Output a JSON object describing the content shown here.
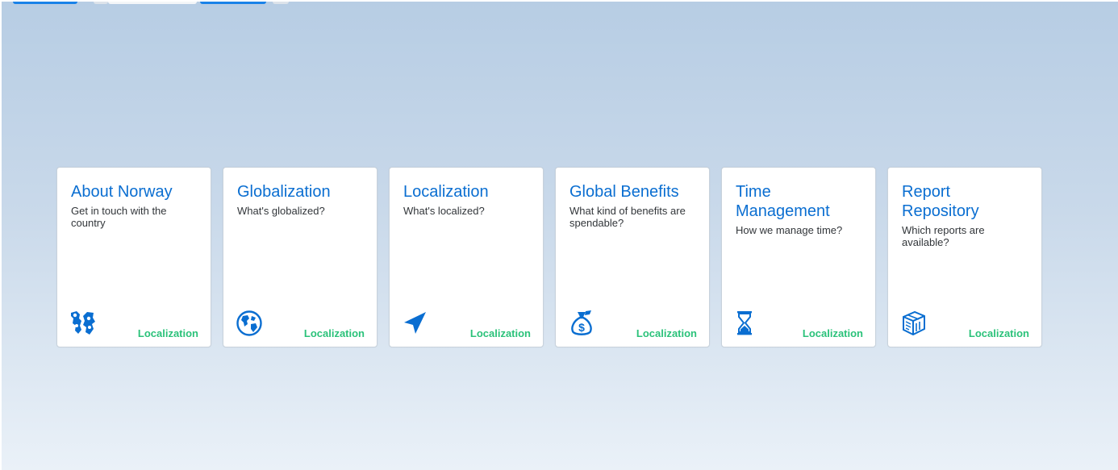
{
  "colors": {
    "tile_title": "#0a6ed1",
    "tile_footer": "#2bc27a",
    "tile_text": "#32363a",
    "icon": "#0a6ed1"
  },
  "tiles": [
    {
      "title": "About Norway",
      "subtitle": "Get in touch with the country",
      "footer": "Localization",
      "icon": "map-icon"
    },
    {
      "title": "Globalization",
      "subtitle": "What's globalized?",
      "footer": "Localization",
      "icon": "globe-icon"
    },
    {
      "title": "Localization",
      "subtitle": "What's localized?",
      "footer": "Localization",
      "icon": "navigation-arrow-icon"
    },
    {
      "title": "Global Benefits",
      "subtitle": "What kind of benefits are spendable?",
      "footer": "Localization",
      "icon": "money-bag-icon"
    },
    {
      "title": "Time Management",
      "subtitle": "How we manage time?",
      "footer": "Localization",
      "icon": "hourglass-icon"
    },
    {
      "title": "Report Repository",
      "subtitle": "Which reports are available?",
      "footer": "Localization",
      "icon": "report-box-icon"
    }
  ]
}
